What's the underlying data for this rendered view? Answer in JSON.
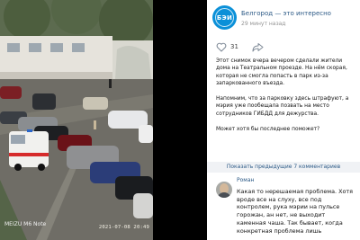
{
  "photo": {
    "watermark_brand": "",
    "watermark_model": "MEIZU M6 Note",
    "timestamp": "2021-07-08  20:49"
  },
  "post": {
    "group_name": "Белгород — это интересно",
    "time": "29 минут назад",
    "logo_text": "БЭИ",
    "likes": "31",
    "paragraphs": [
      "Этот снимок вчера вечером сделали жители дома на Театральном проезде. На нём скорая, которая не смогла попасть в парк из-за запаркованного въезда.",
      "Напомним, что за парковку здесь штрафуют, а мэрия уже пообещала позвать на место сотрудников ГИБДД для дежурства.",
      "Может хотя бы последнее поможет?"
    ],
    "show_previous": "Показать предыдущие 7 комментариев",
    "accent": "#2a5885",
    "brand": "#0b90d8"
  },
  "comment": {
    "author": "Роман",
    "text": "Какая то нерешаемая проблема. Хотя вроде все на слуху, все под контролем, рука мэрии на пульсе горожан, ан нет, не выходит каменная чаша. Так бывает, когда конкретная проблема лишь"
  },
  "icons": {
    "like": "heart-outline-icon",
    "share": "share-arrow-icon"
  }
}
